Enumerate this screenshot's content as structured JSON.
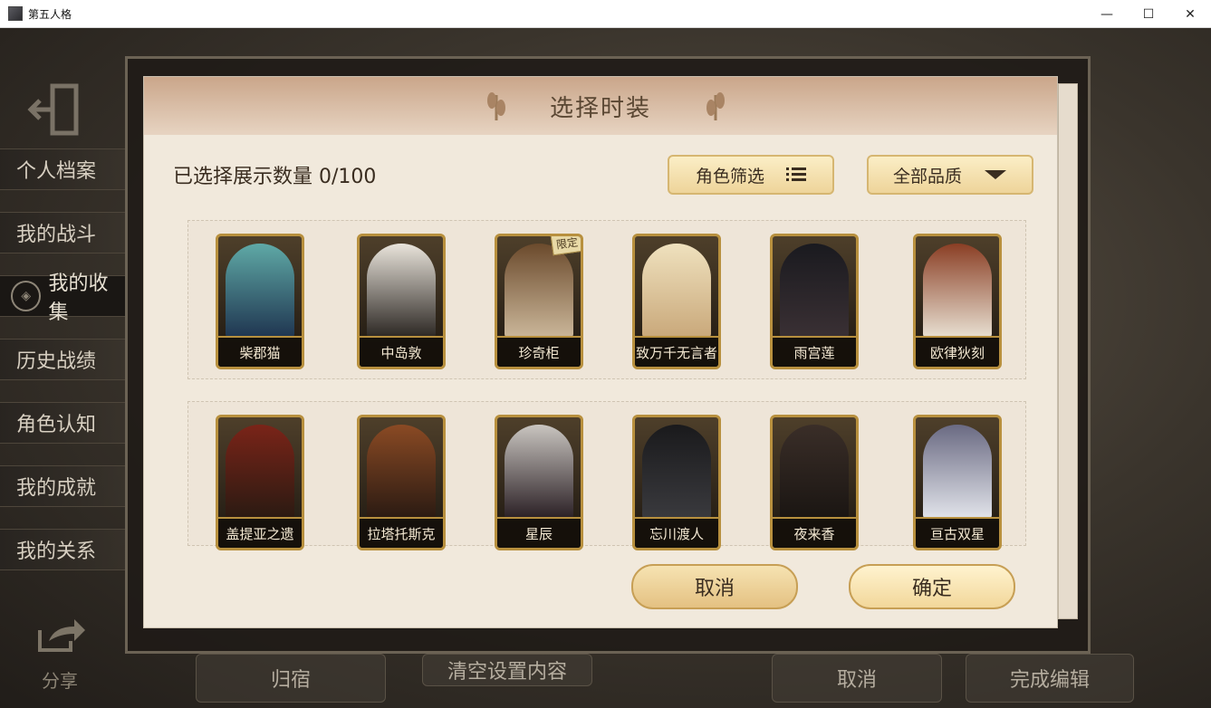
{
  "window": {
    "title": "第五人格",
    "controls": [
      "—",
      "☐",
      "✕"
    ]
  },
  "sidebar": {
    "items": [
      {
        "label": "个人档案"
      },
      {
        "label": "我的战斗"
      },
      {
        "label": "我的收集"
      },
      {
        "label": "历史战绩"
      },
      {
        "label": "角色认知"
      },
      {
        "label": "我的成就"
      },
      {
        "label": "我的关系"
      }
    ],
    "active_index": 2,
    "share_label": "分享"
  },
  "background_bar": {
    "buttons": [
      "归宿",
      "清空设置内容",
      "取消",
      "完成编辑"
    ]
  },
  "dialog": {
    "title": "选择时装",
    "count_label": "已选择展示数量 0/100",
    "filter_role_label": "角色筛选",
    "filter_quality_label": "全部品质",
    "costumes_row1": [
      {
        "name": "柴郡猫"
      },
      {
        "name": "中岛敦"
      },
      {
        "name": "珍奇柜",
        "badge": "限定"
      },
      {
        "name": "致万千无言者"
      },
      {
        "name": "雨宫莲"
      },
      {
        "name": "欧律狄刻"
      }
    ],
    "costumes_row2": [
      {
        "name": "盖提亚之遗"
      },
      {
        "name": "拉塔托斯克"
      },
      {
        "name": "星辰"
      },
      {
        "name": "忘川渡人"
      },
      {
        "name": "夜来香"
      },
      {
        "name": "亘古双星"
      }
    ],
    "cancel_label": "取消",
    "confirm_label": "确定"
  },
  "colors": {
    "accent_gold": "#b8903e",
    "dialog_bg": "#f1e9dc",
    "button_gold": "#eed49a"
  }
}
